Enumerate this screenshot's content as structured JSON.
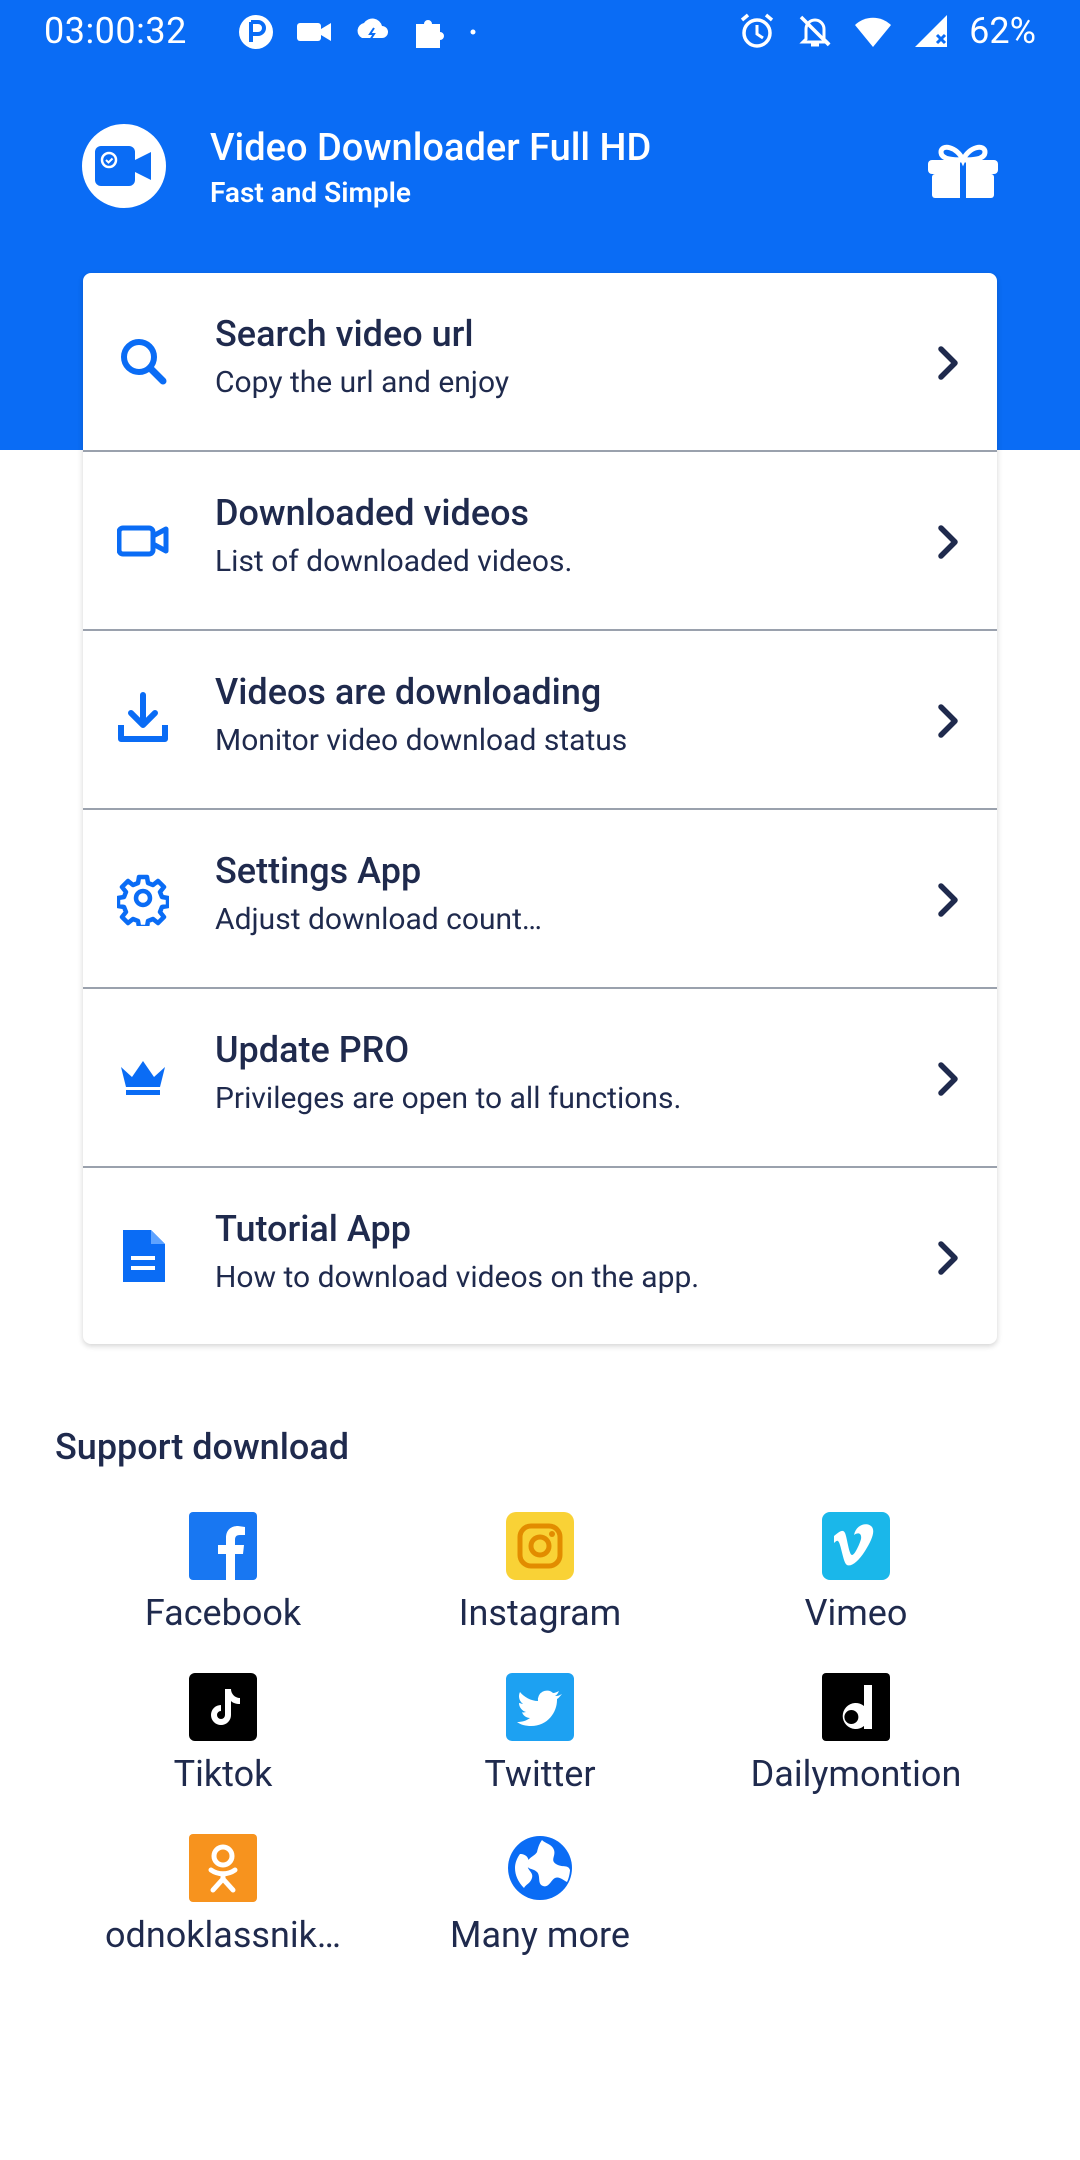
{
  "status_bar": {
    "time": "03:00:32",
    "battery": "62%"
  },
  "header": {
    "title": "Video Downloader Full HD",
    "subtitle": "Fast and Simple"
  },
  "menu": [
    {
      "title": "Search video url",
      "subtitle": "Copy the url and enjoy",
      "icon": "search-icon"
    },
    {
      "title": "Downloaded videos",
      "subtitle": "List of downloaded videos.",
      "icon": "video-camera-icon"
    },
    {
      "title": "Videos are downloading",
      "subtitle": "Monitor video download status",
      "icon": "download-icon"
    },
    {
      "title": "Settings App",
      "subtitle": "Adjust download count…",
      "icon": "gear-icon"
    },
    {
      "title": "Update PRO",
      "subtitle": "Privileges are open to all functions.",
      "icon": "crown-icon"
    },
    {
      "title": "Tutorial App",
      "subtitle": "How to download videos on the app.",
      "icon": "document-icon"
    }
  ],
  "support": {
    "title": "Support download",
    "platforms": [
      {
        "label": "Facebook",
        "icon": "facebook-icon",
        "color": "#1877f2"
      },
      {
        "label": "Instagram",
        "icon": "instagram-icon",
        "color": "#f9d236"
      },
      {
        "label": "Vimeo",
        "icon": "vimeo-icon",
        "color": "#1ab7ea"
      },
      {
        "label": "Tiktok",
        "icon": "tiktok-icon",
        "color": "#000000"
      },
      {
        "label": "Twitter",
        "icon": "twitter-icon",
        "color": "#1da1f2"
      },
      {
        "label": "Dailymontion",
        "icon": "dailymotion-icon",
        "color": "#000000"
      },
      {
        "label": "odnoklassnik…",
        "icon": "odnoklassniki-icon",
        "color": "#f7931e"
      },
      {
        "label": "Many more",
        "icon": "globe-icon",
        "color": "#0a6cf5"
      }
    ]
  },
  "colors": {
    "primary": "#0a6cf5",
    "text": "#1f2a4d"
  }
}
